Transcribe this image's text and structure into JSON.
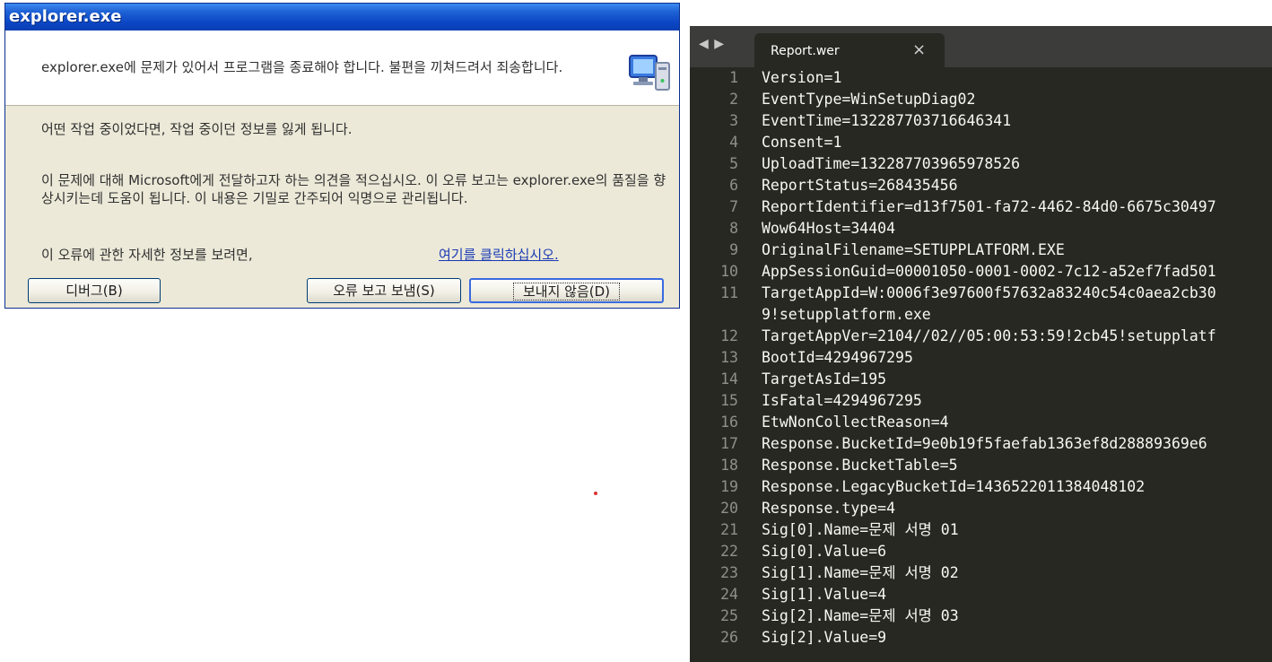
{
  "dialog": {
    "title": "explorer.exe",
    "header_text": "explorer.exe에 문제가 있어서 프로그램을 종료해야 합니다. 불편을 끼쳐드려서 죄송합니다.",
    "text_1": "어떤 작업 중이었다면, 작업 중이던 정보를 잃게 됩니다.",
    "text_2": "이 문제에 대해 Microsoft에게 전달하고자 하는 의견을 적으십시오. 이 오류 보고는 explorer.exe의 품질을 향상시키는데 도움이 됩니다. 이 내용은 기밀로 간주되어 익명으로 관리됩니다.",
    "text_3": "이 오류에 관한 자세한 정보를 보려면,",
    "link": "여기를 클릭하십시오.",
    "buttons": {
      "debug": "디버그(B)",
      "send": "오류 보고 보냄(S)",
      "dont_send": "보내지 않음(D)"
    },
    "icon": "computer-icon"
  },
  "editor": {
    "nav": "◀ ▶",
    "tab_title": "Report.wer",
    "tab_close": "×",
    "lines": [
      {
        "n": "1",
        "t": "Version=1"
      },
      {
        "n": "2",
        "t": "EventType=WinSetupDiag02"
      },
      {
        "n": "3",
        "t": "EventTime=132287703716646341"
      },
      {
        "n": "4",
        "t": "Consent=1"
      },
      {
        "n": "5",
        "t": "UploadTime=132287703965978526"
      },
      {
        "n": "6",
        "t": "ReportStatus=268435456"
      },
      {
        "n": "7",
        "t": "ReportIdentifier=d13f7501-fa72-4462-84d0-6675c30497"
      },
      {
        "n": "8",
        "t": "Wow64Host=34404"
      },
      {
        "n": "9",
        "t": "OriginalFilename=SETUPPLATFORM.EXE"
      },
      {
        "n": "10",
        "t": "AppSessionGuid=00001050-0001-0002-7c12-a52ef7fad501"
      },
      {
        "n": "11",
        "t": "TargetAppId=W:0006f3e97600f57632a83240c54c0aea2cb30\n9!setupplatform.exe"
      },
      {
        "n": "12",
        "t": "TargetAppVer=2104//02//05:00:53:59!2cb45!setupplatf"
      },
      {
        "n": "13",
        "t": "BootId=4294967295"
      },
      {
        "n": "14",
        "t": "TargetAsId=195"
      },
      {
        "n": "15",
        "t": "IsFatal=4294967295"
      },
      {
        "n": "16",
        "t": "EtwNonCollectReason=4"
      },
      {
        "n": "17",
        "t": "Response.BucketId=9e0b19f5faefab1363ef8d28889369e6"
      },
      {
        "n": "18",
        "t": "Response.BucketTable=5"
      },
      {
        "n": "19",
        "t": "Response.LegacyBucketId=1436522011384048102"
      },
      {
        "n": "20",
        "t": "Response.type=4"
      },
      {
        "n": "21",
        "t": "Sig[0].Name=문제 서명 01"
      },
      {
        "n": "22",
        "t": "Sig[0].Value=6"
      },
      {
        "n": "23",
        "t": "Sig[1].Name=문제 서명 02"
      },
      {
        "n": "24",
        "t": "Sig[1].Value=4"
      },
      {
        "n": "25",
        "t": "Sig[2].Name=문제 서명 03"
      },
      {
        "n": "26",
        "t": "Sig[2].Value=9"
      }
    ]
  },
  "colors": {
    "xp_title_blue": "#0b46c4",
    "dialog_bg": "#ece9d8",
    "editor_bg": "#272822",
    "editor_text": "#f8f8f2",
    "line_number": "#8f908a"
  }
}
